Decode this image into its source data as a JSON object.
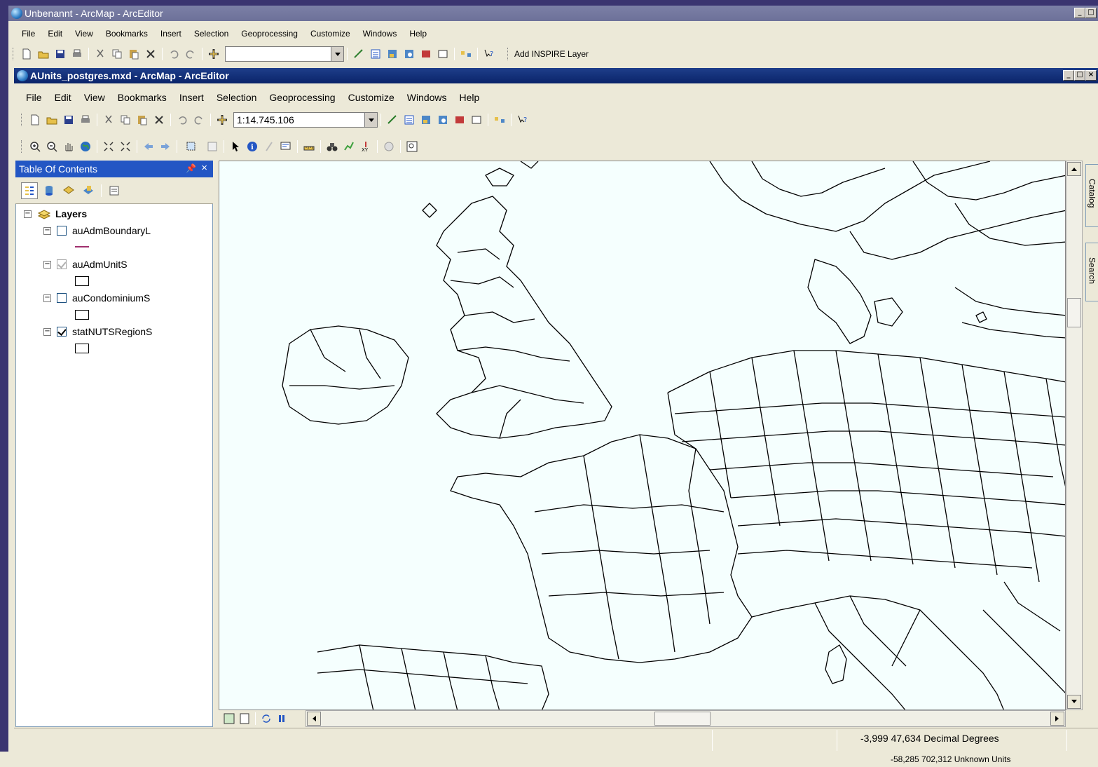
{
  "outer_window": {
    "title": "Unbenannt - ArcMap - ArcEditor",
    "menu": [
      "File",
      "Edit",
      "View",
      "Bookmarks",
      "Insert",
      "Selection",
      "Geoprocessing",
      "Customize",
      "Windows",
      "Help"
    ],
    "scale_value": "",
    "add_inspire_label": "Add INSPIRE Layer"
  },
  "inner_window": {
    "title": "AUnits_postgres.mxd - ArcMap - ArcEditor",
    "menu": [
      "File",
      "Edit",
      "View",
      "Bookmarks",
      "Insert",
      "Selection",
      "Geoprocessing",
      "Customize",
      "Windows",
      "Help"
    ],
    "scale_value": "1:14.745.106"
  },
  "toc": {
    "title": "Table Of Contents",
    "group_label": "Layers",
    "layers": [
      {
        "name": "auAdmBoundaryL",
        "checked": false,
        "symbol": "line",
        "symbol_color": "#a0306e"
      },
      {
        "name": "auAdmUnitS",
        "checked": "gray",
        "symbol": "polygon"
      },
      {
        "name": "auCondominiumS",
        "checked": false,
        "symbol": "polygon"
      },
      {
        "name": "statNUTSRegionS",
        "checked": true,
        "symbol": "polygon"
      }
    ]
  },
  "side_tabs": {
    "catalog": "Catalog",
    "search": "Search"
  },
  "status": {
    "coords_decimal": "-3,999  47,634 Decimal Degrees",
    "coords_units": "-58,285  702,312 Unknown Units"
  },
  "colors": {
    "outer_title": "#6d7199",
    "inner_title": "#0a246a",
    "toc_title": "#2356c4",
    "map_background": "#f5fffe",
    "chrome": "#ece9d8"
  }
}
